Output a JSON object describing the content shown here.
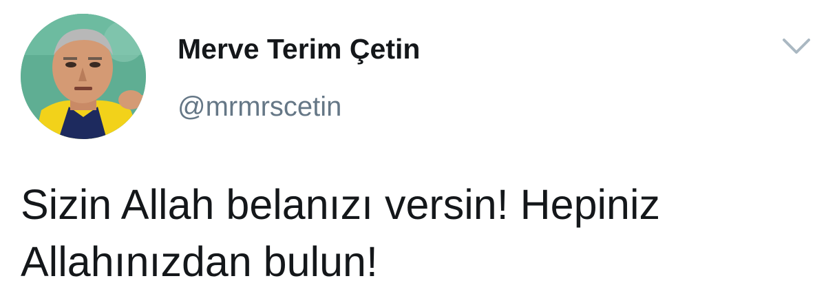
{
  "author": {
    "display_name": "Merve Terim Çetin",
    "handle": "@mrmrscetin",
    "avatar_icon": "profile-photo"
  },
  "tweet": {
    "text": "Sizin Allah belanızı versin! Hepiniz\nAllahınızdan bulun!"
  },
  "menu": {
    "icon": "chevron-down-icon"
  },
  "colors": {
    "name": "#14171a",
    "handle": "#657786",
    "caret": "#aab8c2"
  }
}
